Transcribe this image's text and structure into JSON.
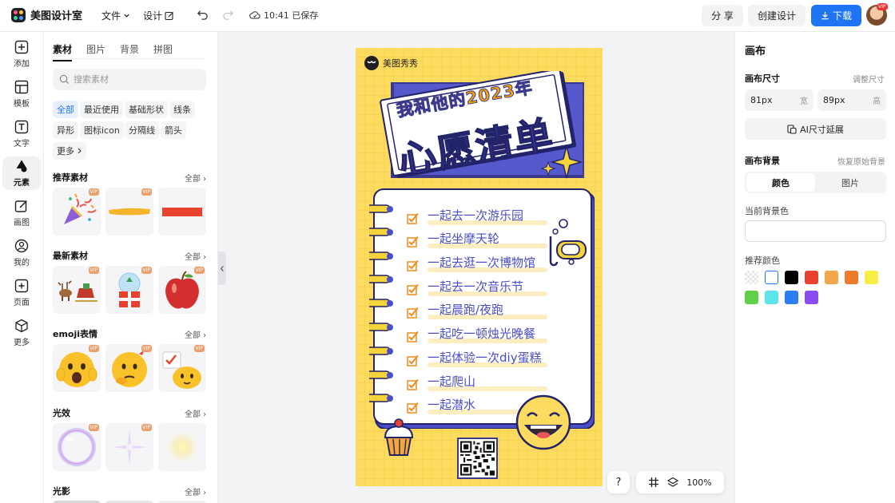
{
  "app": {
    "name": "美图设计室"
  },
  "topbar": {
    "file_menu": "文件",
    "design_menu": "设计",
    "saved_status": "10:41 已保存",
    "share": "分 享",
    "create": "创建设计",
    "download": "下载",
    "avatar_badge": "VIP"
  },
  "rail": {
    "items": [
      "添加",
      "模板",
      "文字",
      "元素",
      "画图",
      "我的",
      "页面",
      "更多"
    ],
    "active": "元素"
  },
  "panel": {
    "tabs": [
      "素材",
      "图片",
      "背景",
      "拼图"
    ],
    "search_placeholder": "搜索素材",
    "chips": [
      "全部",
      "最近使用",
      "基础形状",
      "线条",
      "异形",
      "图标icon",
      "分隔线",
      "箭头",
      "更多"
    ],
    "all_label": "全部",
    "sections": [
      "推荐素材",
      "最新素材",
      "emoji表情",
      "光效",
      "光影"
    ],
    "vip_label": "VIP"
  },
  "canvas": {
    "brand": "美图秀秀",
    "title_line1": "我和他的2023年",
    "title_line2": "心愿清单",
    "wishes": [
      "一起去一次游乐园",
      "一起坐摩天轮",
      "一起去逛一次博物馆",
      "一起去一次音乐节",
      "一起晨跑/夜跑",
      "一起吃一顿烛光晚餐",
      "一起体验一次diy蛋糕",
      "一起爬山",
      "一起潜水"
    ],
    "zoom": "100%",
    "help": "?"
  },
  "right_panel": {
    "title": "画布",
    "size_label": "画布尺寸",
    "resize_link": "调整尺寸",
    "width_value": "81px",
    "width_unit": "宽",
    "height_value": "89px",
    "height_unit": "高",
    "ai_extend": "AI尺寸延展",
    "bg_label": "画布背景",
    "restore_bg": "恢复原始背景",
    "seg_color": "颜色",
    "seg_image": "图片",
    "current_bg_label": "当前背景色",
    "recommended_label": "推荐颜色",
    "swatches": [
      "transparent",
      "#ffffff",
      "#000000",
      "#e8412c",
      "#f4a64a",
      "#ee7a2c",
      "#f7ef45",
      "#5fd04a",
      "#5ce6ec",
      "#2c7df0",
      "#8a4cf0"
    ]
  }
}
